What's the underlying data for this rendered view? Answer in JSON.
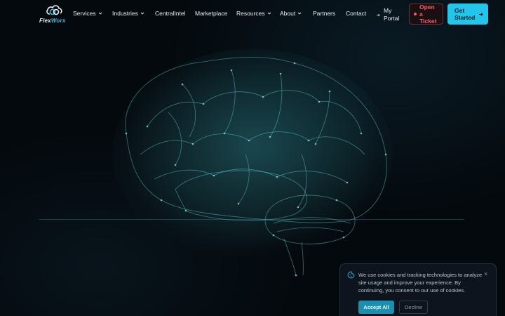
{
  "brand": {
    "name_part1": "Flex",
    "name_part2": "Worx",
    "accent_color": "#25c4ea"
  },
  "nav": {
    "items": [
      {
        "label": "Services",
        "has_dropdown": true
      },
      {
        "label": "Industries",
        "has_dropdown": true
      },
      {
        "label": "CentralIntel",
        "has_dropdown": false
      },
      {
        "label": "Marketplace",
        "has_dropdown": false
      },
      {
        "label": "Resources",
        "has_dropdown": true
      },
      {
        "label": "About",
        "has_dropdown": true
      },
      {
        "label": "Partners",
        "has_dropdown": false
      },
      {
        "label": "Contact",
        "has_dropdown": false
      }
    ],
    "portal_label": "My Portal",
    "ticket_label": "Open a Ticket",
    "start_label": "Get Started",
    "icons": {
      "portal": "login-arrow-icon",
      "ticket": "dot-icon",
      "start": "arrow-right-icon"
    }
  },
  "hero": {
    "graphic": "wireframe-brain-network"
  },
  "cookie_banner": {
    "message": "We use cookies and tracking technologies to analyze site usage and improve your experience. By continuing, you consent to our use of cookies.",
    "accept_label": "Accept All",
    "decline_label": "Decline",
    "close_symbol": "×",
    "icon": "cookie-icon"
  }
}
